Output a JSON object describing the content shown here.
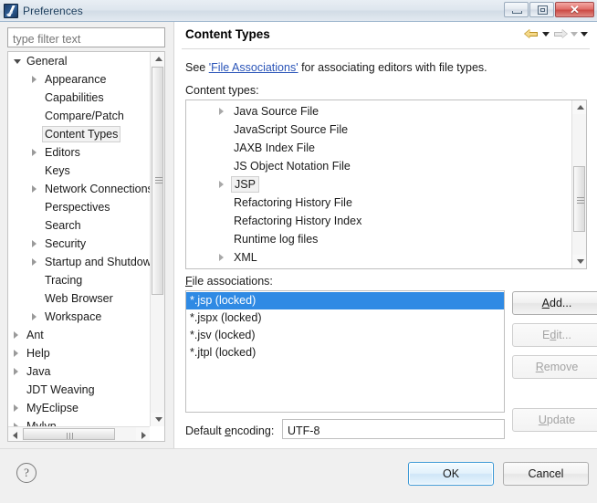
{
  "window": {
    "title": "Preferences",
    "icon": "myeclipse-logo-icon",
    "buttons": {
      "minimize": "minimize-icon",
      "restore": "restore-icon",
      "close": "✕"
    }
  },
  "sidebar": {
    "filter": {
      "placeholder": "type filter text",
      "value": ""
    },
    "items": [
      {
        "label": "General",
        "indent": 0,
        "twisty": "open",
        "selected": false
      },
      {
        "label": "Appearance",
        "indent": 1,
        "twisty": "closed",
        "selected": false
      },
      {
        "label": "Capabilities",
        "indent": 1,
        "twisty": "none",
        "selected": false
      },
      {
        "label": "Compare/Patch",
        "indent": 1,
        "twisty": "none",
        "selected": false
      },
      {
        "label": "Content Types",
        "indent": 1,
        "twisty": "none",
        "selected": true
      },
      {
        "label": "Editors",
        "indent": 1,
        "twisty": "closed",
        "selected": false
      },
      {
        "label": "Keys",
        "indent": 1,
        "twisty": "none",
        "selected": false
      },
      {
        "label": "Network Connections",
        "indent": 1,
        "twisty": "closed",
        "selected": false
      },
      {
        "label": "Perspectives",
        "indent": 1,
        "twisty": "none",
        "selected": false
      },
      {
        "label": "Search",
        "indent": 1,
        "twisty": "none",
        "selected": false
      },
      {
        "label": "Security",
        "indent": 1,
        "twisty": "closed",
        "selected": false
      },
      {
        "label": "Startup and Shutdown",
        "indent": 1,
        "twisty": "closed",
        "selected": false
      },
      {
        "label": "Tracing",
        "indent": 1,
        "twisty": "none",
        "selected": false
      },
      {
        "label": "Web Browser",
        "indent": 1,
        "twisty": "none",
        "selected": false
      },
      {
        "label": "Workspace",
        "indent": 1,
        "twisty": "closed",
        "selected": false
      },
      {
        "label": "Ant",
        "indent": 0,
        "twisty": "closed",
        "selected": false
      },
      {
        "label": "Help",
        "indent": 0,
        "twisty": "closed",
        "selected": false
      },
      {
        "label": "Java",
        "indent": 0,
        "twisty": "closed",
        "selected": false
      },
      {
        "label": "JDT Weaving",
        "indent": 0,
        "twisty": "none",
        "selected": false
      },
      {
        "label": "MyEclipse",
        "indent": 0,
        "twisty": "closed",
        "selected": false
      },
      {
        "label": "Mylyn",
        "indent": 0,
        "twisty": "closed",
        "selected": false
      }
    ]
  },
  "page": {
    "title": "Content Types",
    "nav": {
      "back_icon": "back-arrow-icon",
      "back_menu_icon": "chevron-down-icon",
      "forward_icon": "forward-arrow-icon",
      "forward_menu_icon": "chevron-down-icon",
      "menu_icon": "chevron-down-icon"
    },
    "description_prefix": "See ",
    "description_link": "'File Associations'",
    "description_suffix": " for associating editors with file types.",
    "content_types_label": "Content types:",
    "content_types": [
      {
        "label": "Java Source File",
        "twisty": "closed",
        "selected": false
      },
      {
        "label": "JavaScript Source File",
        "twisty": "none",
        "selected": false
      },
      {
        "label": "JAXB Index File",
        "twisty": "none",
        "selected": false
      },
      {
        "label": "JS Object Notation File",
        "twisty": "none",
        "selected": false
      },
      {
        "label": "JSP",
        "twisty": "closed",
        "selected": true
      },
      {
        "label": "Refactoring History File",
        "twisty": "none",
        "selected": false
      },
      {
        "label": "Refactoring History Index",
        "twisty": "none",
        "selected": false
      },
      {
        "label": "Runtime log files",
        "twisty": "none",
        "selected": false
      },
      {
        "label": "XML",
        "twisty": "closed",
        "selected": false
      }
    ],
    "file_associations_label": "File associations:",
    "file_associations": [
      {
        "label": "*.jsp (locked)",
        "selected": true
      },
      {
        "label": "*.jspx (locked)",
        "selected": false
      },
      {
        "label": "*.jsv (locked)",
        "selected": false
      },
      {
        "label": "*.jtpl (locked)",
        "selected": false
      }
    ],
    "buttons": {
      "add": "Add...",
      "edit": "Edit...",
      "remove": "Remove",
      "update": "Update"
    },
    "default_encoding_label": "Default encoding:",
    "default_encoding_value": "UTF-8"
  },
  "footer": {
    "help_icon": "help-icon",
    "help_glyph": "?",
    "ok": "OK",
    "cancel": "Cancel"
  },
  "colors": {
    "selection_blue": "#2f8ae4",
    "link_blue": "#2a54b8",
    "back_arrow_gold": "#f5d98a",
    "close_red": "#cc4b45",
    "default_button_border": "#3e9ad6"
  }
}
